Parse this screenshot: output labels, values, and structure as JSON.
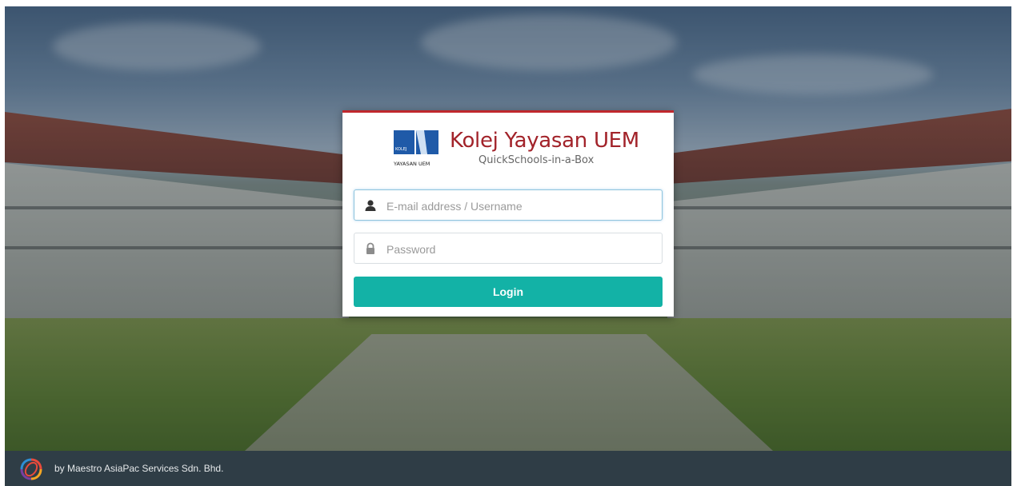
{
  "brand": {
    "name": "Kolej Yayasan UEM",
    "subtitle": "QuickSchools-in-a-Box",
    "logo_text_top": "KOLEJ",
    "logo_text_bottom": "YAYASAN UEM"
  },
  "form": {
    "username_placeholder": "E-mail address / Username",
    "username_value": "",
    "password_placeholder": "Password",
    "password_value": "",
    "login_label": "Login"
  },
  "footer": {
    "text": "by Maestro AsiaPac Services Sdn. Bhd."
  },
  "icons": {
    "username": "user-icon",
    "password": "lock-icon",
    "footer_logo": "maestro-logo-icon"
  },
  "colors": {
    "brand_red": "#a2232a",
    "accent_teal": "#13b2a6",
    "footer_bg": "#2f3d46"
  }
}
